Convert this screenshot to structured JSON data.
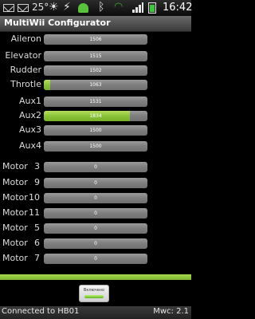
{
  "status_bar": {
    "temperature": "25°",
    "time": "16:42",
    "icons": [
      "mail-icon",
      "mail-icon",
      "sun-icon",
      "usb-icon",
      "android-icon",
      "bluetooth-icon",
      "wifi-icon",
      "signal-icon",
      "battery-icon"
    ]
  },
  "app": {
    "title": "MultiWii Configurator"
  },
  "channels": [
    {
      "label": "Aileron",
      "value": "1506",
      "fill": 0.0
    },
    {
      "label": "Elevator",
      "value": "1515",
      "fill": 0.0
    },
    {
      "label": "Rudder",
      "value": "1502",
      "fill": 0.0
    },
    {
      "label": "Throtle",
      "value": "1063",
      "fill": 0.06
    },
    {
      "label": "Aux1",
      "value": "1531",
      "fill": 0.0
    },
    {
      "label": "Aux2",
      "value": "1834",
      "fill": 0.83
    },
    {
      "label": "Aux3",
      "value": "1500",
      "fill": 0.0
    },
    {
      "label": "Aux4",
      "value": "1500",
      "fill": 0.0
    }
  ],
  "motors": [
    {
      "label": "Motor",
      "number": "3",
      "value": "0"
    },
    {
      "label": "Motor",
      "number": "9",
      "value": "0"
    },
    {
      "label": "Motor",
      "number": "10",
      "value": "0"
    },
    {
      "label": "Motor",
      "number": "11",
      "value": "0"
    },
    {
      "label": "Motor",
      "number": "5",
      "value": "0"
    },
    {
      "label": "Motor",
      "number": "6",
      "value": "0"
    },
    {
      "label": "Motor",
      "number": "7",
      "value": "0"
    }
  ],
  "controls": {
    "toggle_label": "Включено"
  },
  "footer": {
    "connection": "Connected to HB01",
    "version": "Mwc: 2.1"
  },
  "colors": {
    "accent": "#8ac33a",
    "bar_bg": "#7e7e7e"
  }
}
